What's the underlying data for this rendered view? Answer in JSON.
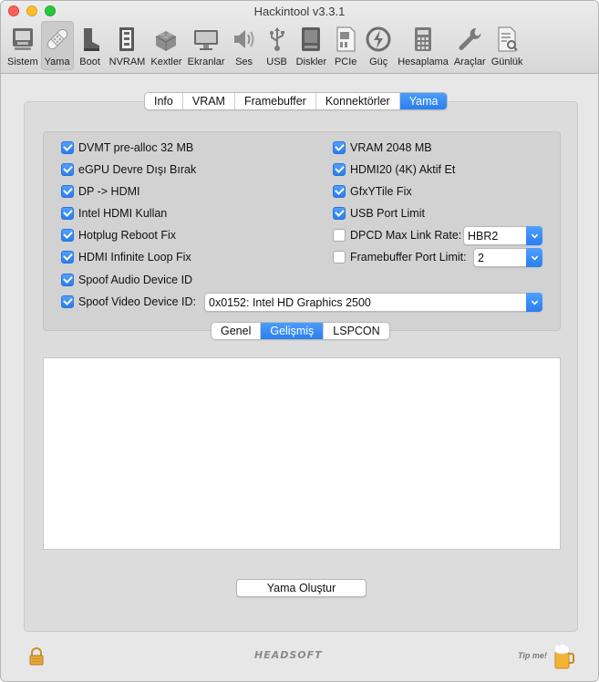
{
  "window": {
    "title": "Hackintool v3.3.1"
  },
  "toolbar": [
    {
      "label": "Sistem",
      "icon": "computer-icon"
    },
    {
      "label": "Yama",
      "icon": "bandage-icon",
      "active": true
    },
    {
      "label": "Boot",
      "icon": "boot-icon"
    },
    {
      "label": "NVRAM",
      "icon": "memory-chip-icon"
    },
    {
      "label": "Kextler",
      "icon": "lego-brick-icon"
    },
    {
      "label": "Ekranlar",
      "icon": "display-icon"
    },
    {
      "label": "Ses",
      "icon": "speaker-icon"
    },
    {
      "label": "USB",
      "icon": "usb-icon"
    },
    {
      "label": "Diskler",
      "icon": "disk-icon"
    },
    {
      "label": "PCIe",
      "icon": "pcie-card-icon"
    },
    {
      "label": "Güç",
      "icon": "power-bolt-icon"
    },
    {
      "label": "Hesaplama",
      "icon": "calculator-icon"
    },
    {
      "label": "Araçlar",
      "icon": "wrench-icon"
    },
    {
      "label": "Günlük",
      "icon": "log-document-icon"
    }
  ],
  "tabs": [
    "Info",
    "VRAM",
    "Framebuffer",
    "Konnektörler",
    "Yama"
  ],
  "tabs_selected": "Yama",
  "left_checks": [
    {
      "label": "DVMT pre-alloc 32 MB",
      "checked": true
    },
    {
      "label": "eGPU Devre Dışı Bırak",
      "checked": true
    },
    {
      "label": "DP -> HDMI",
      "checked": true
    },
    {
      "label": "Intel HDMI Kullan",
      "checked": true
    },
    {
      "label": "Hotplug Reboot Fix",
      "checked": true
    },
    {
      "label": "HDMI Infinite Loop Fix",
      "checked": true
    },
    {
      "label": "Spoof Audio Device ID",
      "checked": true
    },
    {
      "label": "Spoof Video Device ID:",
      "checked": true
    }
  ],
  "right_checks": [
    {
      "label": "VRAM 2048 MB",
      "checked": true
    },
    {
      "label": "HDMI20 (4K) Aktif Et",
      "checked": true
    },
    {
      "label": "GfxYTile Fix",
      "checked": true
    },
    {
      "label": "USB Port Limit",
      "checked": true
    },
    {
      "label": "DPCD Max Link Rate:",
      "checked": false
    },
    {
      "label": "Framebuffer Port Limit:",
      "checked": false
    }
  ],
  "popups": {
    "link_rate": "HBR2",
    "port_limit": "2",
    "video_device_id": "0x0152: Intel HD Graphics 2500"
  },
  "subtabs": [
    "Genel",
    "Gelişmiş",
    "LSPCON"
  ],
  "subtabs_selected": "Gelişmiş",
  "generate_button": "Yama Oluştur",
  "footer": {
    "brand": "HEADSOFT",
    "tip": "Tip me!"
  },
  "colors": {
    "accent": "#2b7fec",
    "background": "#e7e7e7"
  }
}
